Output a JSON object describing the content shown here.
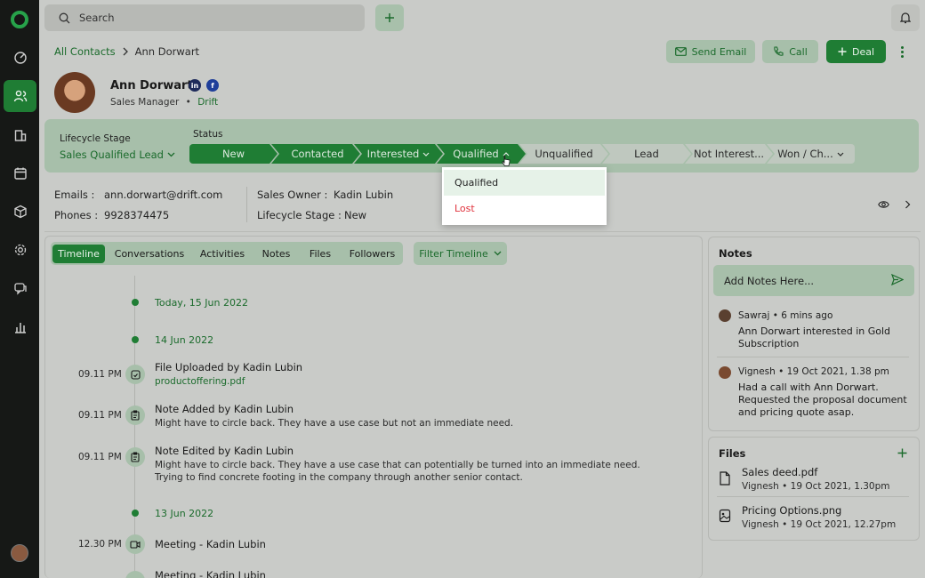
{
  "topbar": {
    "search_placeholder": "Search"
  },
  "breadcrumb": {
    "parent": "All Contacts",
    "current": "Ann Dorwart"
  },
  "actions": {
    "send_email": "Send Email",
    "call": "Call",
    "deal": "Deal"
  },
  "profile": {
    "name": "Ann Dorwart",
    "title": "Sales Manager",
    "separator": "•",
    "company": "Drift",
    "social": [
      "linkedin-icon",
      "facebook-icon"
    ]
  },
  "lifecycle": {
    "label": "Lifecycle Stage",
    "value": "Sales Qualified Lead"
  },
  "status": {
    "label": "Status",
    "stages": [
      "New",
      "Contacted",
      "Interested",
      "Qualified",
      "Unqualified",
      "Lead",
      "Not Interest...",
      "Won / Ch..."
    ],
    "current": "Qualified"
  },
  "dropdown": {
    "options": [
      "Qualified",
      "Lost"
    ],
    "selected": "Qualified"
  },
  "contact_info": {
    "emails_label": "Emails :",
    "email": "ann.dorwart@drift.com",
    "phones_label": "Phones :",
    "phone": "9928374475",
    "owner_label": "Sales Owner :",
    "owner": "Kadin Lubin",
    "stage_label": "Lifecycle Stage :",
    "stage": "New"
  },
  "timeline": {
    "tabs": [
      "Timeline",
      "Conversations",
      "Activities",
      "Notes",
      "Files",
      "Followers"
    ],
    "active_tab": "Timeline",
    "filter_label": "Filter Timeline",
    "dates": [
      "Today, 15 Jun 2022",
      "14 Jun 2022",
      "13 Jun 2022"
    ],
    "events": [
      {
        "time": "09.11 PM",
        "title": "File Uploaded by Kadin Lubin",
        "file": "productoffering.pdf"
      },
      {
        "time": "09.11 PM",
        "title": "Note Added by Kadin Lubin",
        "desc": "Might have to circle back. They have a use case but not an immediate need."
      },
      {
        "time": "09.11 PM",
        "title": "Note Edited by Kadin Lubin",
        "desc": "Might have to circle back. They have a use case that can potentially be turned into an immediate need. Trying to find concrete footing in the company through another senior contact."
      },
      {
        "time": "12.30 PM",
        "title": "Meeting - Kadin Lubin"
      },
      {
        "title": "Meeting - Kadin Lubin"
      }
    ]
  },
  "notes": {
    "title": "Notes",
    "input_placeholder": "Add Notes Here...",
    "items": [
      {
        "author": "Sawraj",
        "time": "• 6 mins ago",
        "text": "Ann Dorwart interested in Gold Subscription"
      },
      {
        "author": "Vignesh",
        "time": "•  19 Oct 2021, 1.38 pm",
        "text": "Had a call with Ann Dorwart. Requested the proposal document and pricing quote asap."
      }
    ]
  },
  "files": {
    "title": "Files",
    "items": [
      {
        "name": "Sales deed.pdf",
        "meta": "Vignesh  •  19 Oct 2021, 1.30pm"
      },
      {
        "name": "Pricing Options.png",
        "meta": "Vignesh  •  19 Oct 2021, 12.27pm"
      }
    ]
  },
  "colors": {
    "accent": "#1f7d34",
    "accent_light": "#a7bfaa",
    "danger": "#e0323c",
    "sidebar": "#161816"
  }
}
